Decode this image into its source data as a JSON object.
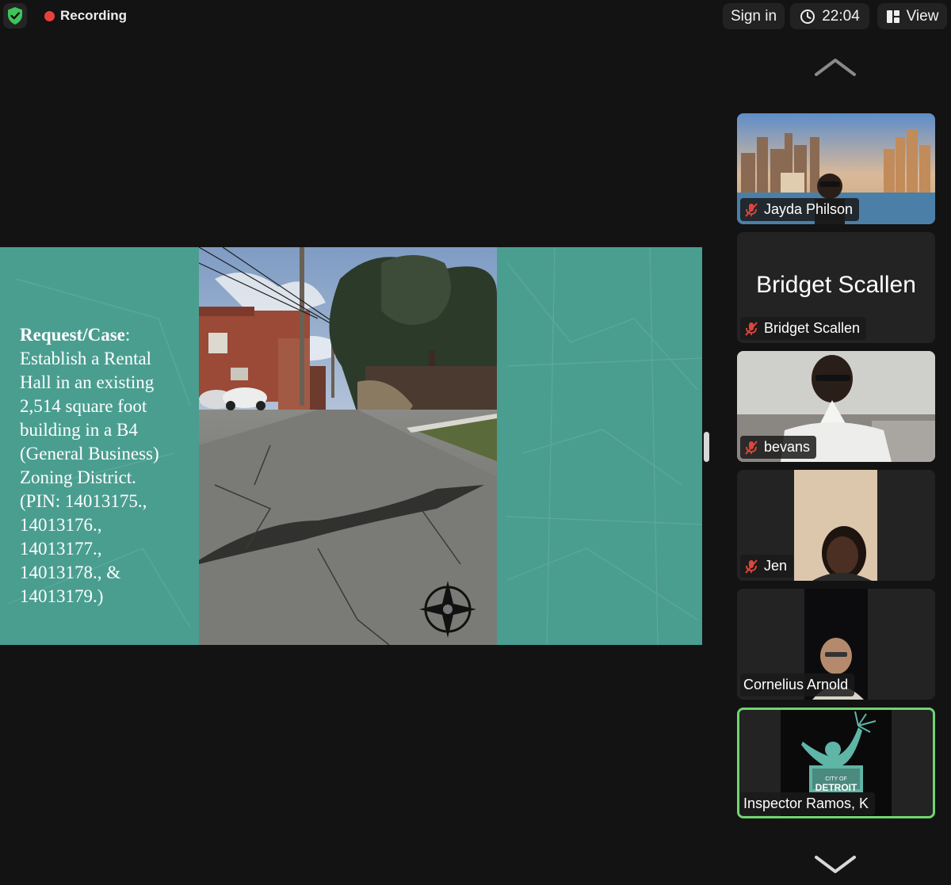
{
  "header": {
    "recording_label": "Recording",
    "sign_in_label": "Sign in",
    "time": "22:04",
    "view_label": "View"
  },
  "slide": {
    "heading": "Request/Case",
    "heading_suffix": ":",
    "body_lines": [
      "Establish a Rental",
      "Hall in an existing",
      "2,514 square foot",
      "building in a B4",
      "(General Business)",
      "Zoning District.",
      "(PIN: 14013175.,",
      "14013176.,",
      "14013177.,",
      "14013178., &",
      "14013179.)"
    ]
  },
  "participants": [
    {
      "name": "Jayda Philson",
      "muted": true
    },
    {
      "name": "Bridget Scallen",
      "display_name": "Bridget Scallen",
      "muted": true
    },
    {
      "name": "bevans",
      "muted": true
    },
    {
      "name": "Jen",
      "muted": true
    },
    {
      "name": "Cornelius Arnold",
      "muted": false
    },
    {
      "name": "Inspector Ramos, K",
      "muted": false,
      "active_speaker": true,
      "logo_lines": [
        "CITY OF",
        "DETROIT"
      ]
    }
  ],
  "colors": {
    "background": "#131313",
    "slide_teal": "#4a9e90",
    "recording_red": "#e8403a",
    "shield_green": "#3ec45a",
    "active_border": "#6fd66f",
    "muted_red": "#e0453c"
  }
}
